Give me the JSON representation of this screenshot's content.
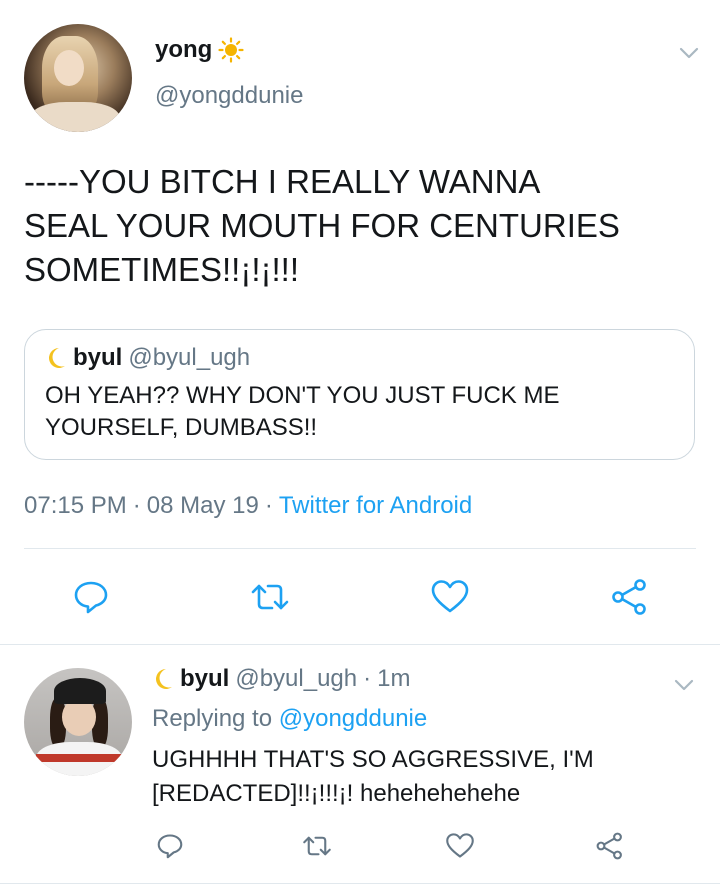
{
  "colors": {
    "text": "#14171a",
    "secondary": "#657786",
    "accent": "#1da1f2",
    "border": "#e1e8ed",
    "sun": "#f5b400"
  },
  "main_tweet": {
    "display_name": "yong",
    "name_emoji": "sun-icon",
    "handle": "@yongddunie",
    "text": "-----YOU BITCH I REALLY WANNA\nSEAL YOUR MOUTH FOR CENTURIES\nSOMETIMES!!¡!¡!!!",
    "quoted": {
      "name_emoji": "moon-icon",
      "display_name": "byul",
      "handle": "@byul_ugh",
      "text": "OH YEAH?? WHY DON'T YOU JUST FUCK ME YOURSELF, DUMBASS!!"
    },
    "time": "07:15 PM",
    "date": "08 May 19",
    "separator": "·",
    "source": "Twitter for Android"
  },
  "reply_tweet": {
    "name_emoji": "moon-icon",
    "display_name": "byul",
    "handle": "@byul_ugh",
    "separator": "·",
    "age": "1m",
    "replying_prefix": "Replying to",
    "replying_mention": "@yongddunie",
    "text": "UGHHHH THAT'S SO AGGRESSIVE, I'M [REDACTED]!!¡!!!¡! hehehehehehe"
  },
  "actions": [
    "reply-icon",
    "retweet-icon",
    "like-icon",
    "share-icon"
  ]
}
